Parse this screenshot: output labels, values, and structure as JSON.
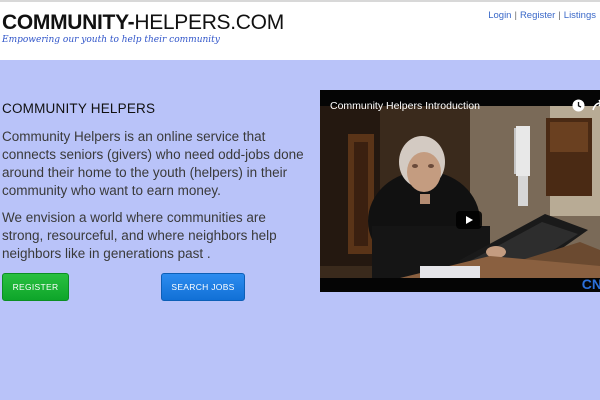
{
  "header": {
    "logo_bold": "COMMUNITY-",
    "logo_light": "HELPERS.COM",
    "tagline": "Empowering our youth to help their community",
    "links": [
      "Login",
      "Register",
      "Listings"
    ],
    "separator": "|"
  },
  "main": {
    "heading": "COMMUNITY HELPERS",
    "paragraph1": "Community Helpers is an online service that connects seniors (givers) who need odd-jobs done around their home to the youth (helpers) in their community who want to earn money.",
    "paragraph2": "We envision a world where communities are strong, resourceful, and where neighbors help neighbors like in generations past .",
    "register_button": "REGISTER",
    "search_button": "SEARCH JOBS"
  },
  "video": {
    "title": "Community Helpers Introduction",
    "icons": [
      "clock-icon",
      "share-icon",
      "play-icon"
    ],
    "corner_logo": "CN"
  },
  "colors": {
    "page_background": "#b9c3f9",
    "header_background": "#ffffff",
    "link": "#3a68c8",
    "tagline": "#2f54c9",
    "register_button": "#1bb335",
    "search_button": "#1f7ee6"
  }
}
